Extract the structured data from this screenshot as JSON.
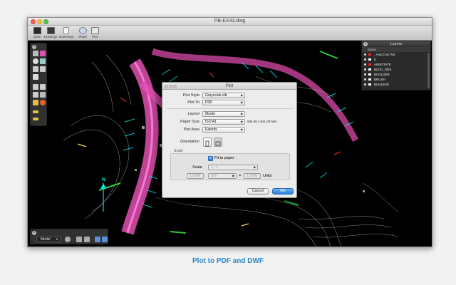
{
  "window": {
    "title": "PB-EX43.dwg"
  },
  "toolbar": {
    "items": [
      {
        "label": "Open",
        "icon": "open-drawing-icon",
        "color": "#2b2b2b"
      },
      {
        "label": "Drawings",
        "icon": "drawings-icon",
        "color": "#3a3a3a"
      },
      {
        "label": "Download",
        "icon": "download-icon",
        "color": "#dcdcdc"
      },
      {
        "label": "Share",
        "icon": "share-icon",
        "color": "#cfd6e0"
      },
      {
        "label": "Plot",
        "icon": "plot-icon",
        "color": "#e6e6e6"
      }
    ]
  },
  "layers": {
    "title": "Layers",
    "column_name": "Name",
    "items": [
      {
        "name": "_AutoCAD WS",
        "color": "#ff2020"
      },
      {
        "name": "0",
        "color": "#ffffff"
      },
      {
        "name": "ANNOTATE",
        "color": "#ff2020"
      },
      {
        "name": "BLDG_OBS",
        "color": "#ffffff"
      },
      {
        "name": "BOULDER",
        "color": "#ffffff"
      },
      {
        "name": "BRUSH",
        "color": "#ffffff"
      },
      {
        "name": "BUILDING",
        "color": "#ffffff"
      }
    ]
  },
  "bottom_bar": {
    "space": "Model"
  },
  "dialog": {
    "title": "Plot",
    "plot_style_label": "Plot Style",
    "plot_style_value": "Grayscale.ctb",
    "plot_to_label": "Plot To",
    "plot_to_value": "PDF",
    "layout_label": "Layout",
    "layout_value": "Model",
    "paper_size_label": "Paper Size",
    "paper_size_value": "ISO A1",
    "paper_size_dims": "594.00 x 841.00 MM",
    "plot_area_label": "Plot Area",
    "plot_area_value": "Extents",
    "orientation_label": "Orientation",
    "scale_section": "Scale",
    "fit_to_paper_label": "Fit to paper",
    "fit_to_paper_checked": true,
    "scale_label": "Scale",
    "scale_value": "1 : 1",
    "scale_num": "1.0000",
    "scale_unit": "mm",
    "scale_equals": "=",
    "scale_den": "1.0000",
    "units_label": "Units",
    "cancel_label": "Cancel",
    "ok_label": "OK"
  },
  "caption": "Plot to PDF and DWF",
  "north_label": "N"
}
